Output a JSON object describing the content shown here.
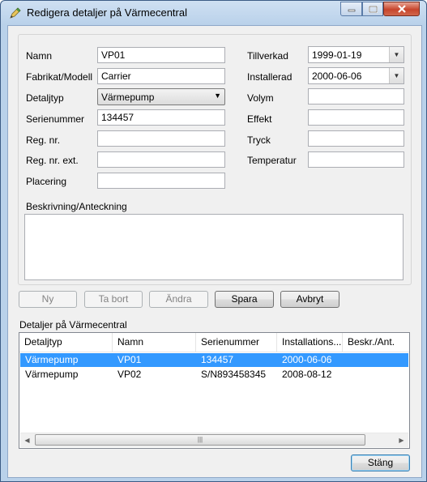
{
  "window": {
    "title": "Redigera detaljer på Värmecentral",
    "icon": "pencil-icon",
    "close_color": "#c7452c"
  },
  "form": {
    "namn": {
      "label": "Namn",
      "value": "VP01"
    },
    "fabrikat": {
      "label": "Fabrikat/Modell",
      "value": "Carrier"
    },
    "detaljtyp": {
      "label": "Detaljtyp",
      "value": "Värmepump"
    },
    "serienummer": {
      "label": "Serienummer",
      "value": "134457"
    },
    "regnr": {
      "label": "Reg. nr.",
      "value": ""
    },
    "regnrext": {
      "label": "Reg. nr. ext.",
      "value": ""
    },
    "placering": {
      "label": "Placering",
      "value": ""
    },
    "tillverkad": {
      "label": "Tillverkad",
      "value": "1999-01-19"
    },
    "installerad": {
      "label": "Installerad",
      "value": "2000-06-06"
    },
    "volym": {
      "label": "Volym",
      "value": ""
    },
    "effekt": {
      "label": "Effekt",
      "value": ""
    },
    "tryck": {
      "label": "Tryck",
      "value": ""
    },
    "temperatur": {
      "label": "Temperatur",
      "value": ""
    },
    "beskrivning": {
      "label": "Beskrivning/Anteckning",
      "value": ""
    }
  },
  "buttons": {
    "ny": "Ny",
    "ta_bort": "Ta bort",
    "andra": "Ändra",
    "spara": "Spara",
    "avbryt": "Avbryt",
    "stang": "Stäng"
  },
  "list": {
    "title": "Detaljer på Värmecentral",
    "columns": [
      "Detaljtyp",
      "Namn",
      "Serienummer",
      "Installations...",
      "Beskr./Ant."
    ],
    "rows": [
      [
        "Värmepump",
        "VP01",
        "134457",
        "2000-06-06",
        ""
      ],
      [
        "Värmepump",
        "VP02",
        "S/N893458345",
        "2008-08-12",
        ""
      ]
    ],
    "selected_row": 0,
    "selected_color": "#3399ff"
  }
}
